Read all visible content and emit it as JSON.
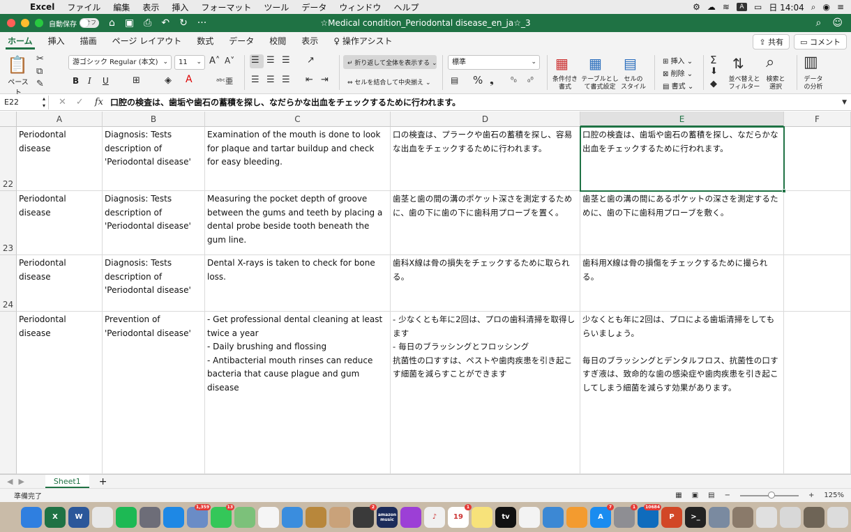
{
  "menubar": {
    "app_name": "Excel",
    "items": [
      "ファイル",
      "編集",
      "表示",
      "挿入",
      "フォーマット",
      "ツール",
      "データ",
      "ウィンドウ",
      "ヘルプ"
    ],
    "clock": "日 14:04",
    "input_method": "A"
  },
  "titlebar": {
    "autosave_label": "自動保存",
    "autosave_state": "オフ",
    "document_title": "☆Medical condition_Periodontal disease_en_ja☆_3"
  },
  "ribbon_tabs": {
    "items": [
      "ホーム",
      "挿入",
      "描画",
      "ページ レイアウト",
      "数式",
      "データ",
      "校閲",
      "表示"
    ],
    "assist": "操作アシスト",
    "share": "共有",
    "comment": "コメント"
  },
  "ribbon": {
    "paste": "ペースト",
    "font_name": "游ゴシック Regular (本文)",
    "font_size": "11",
    "bold": "B",
    "italic": "I",
    "underline": "U",
    "wrap_text": "折り返して全体を表示する",
    "merge_center": "セルを結合して中央揃え",
    "number_format": "標準",
    "conditional_format": "条件付き\n書式",
    "format_as_table": "テーブルとして書式設定",
    "cell_styles": "セルの\nスタイル",
    "insert": "挿入",
    "delete": "削除",
    "format": "書式",
    "sort_filter": "並べ替えと\nフィルター",
    "find_select": "検索と\n選択",
    "analyze_data": "データ\nの分析"
  },
  "formula_bar": {
    "name_box": "E22",
    "fx": "fx",
    "formula": "口腔の検査は、歯垢や歯石の蓄積を探し、なだらかな出血をチェックするために行われます。"
  },
  "grid": {
    "columns": [
      "A",
      "B",
      "C",
      "D",
      "E",
      "F"
    ],
    "selected_column": "E",
    "rows": [
      {
        "num": "22",
        "cells": [
          "Periodontal disease",
          "Diagnosis: Tests description of 'Periodontal disease'",
          "Examination of the mouth is done to look for plaque and tartar buildup and check for easy bleeding.",
          "口の検査は、プラークや歯石の蓄積を探し、容易な出血をチェックするために行われます。",
          "口腔の検査は、歯垢や歯石の蓄積を探し、なだらかな出血をチェックするために行われます。",
          ""
        ]
      },
      {
        "num": "23",
        "cells": [
          "Periodontal disease",
          "Diagnosis: Tests description of 'Periodontal disease'",
          "Measuring the pocket depth of groove between the gums and teeth by placing a dental probe beside tooth beneath the gum line.",
          "歯茎と歯の間の溝のポケット深さを測定するために、歯の下に歯の下に歯科用プローブを置く。",
          "歯茎と歯の溝の間にあるポケットの深さを測定するために、歯の下に歯科用プローブを敷く。",
          ""
        ]
      },
      {
        "num": "24",
        "cells": [
          "Periodontal disease",
          "Diagnosis: Tests description of 'Periodontal disease'",
          "Dental X-rays is taken to check for bone loss.",
          "歯科X線は骨の損失をチェックするために取られる。",
          "歯科用X線は骨の損傷をチェックするために撮られる。",
          ""
        ]
      },
      {
        "num": "",
        "cells": [
          "Periodontal disease",
          "Prevention of 'Periodontal disease'",
          "- Get professional dental cleaning at least twice a year\n- Daily brushing and flossing\n- Antibacterial mouth rinses can reduce bacteria that cause plague and gum disease",
          "- 少なくとも年に2回は、プロの歯科清掃を取得します\n- 毎日のブラッシングとフロッシング\n抗菌性の口すすは、ペストや歯肉疾患を引き起こす細菌を減らすことができます",
          "少なくとも年に2回は、プロによる歯垢清掃をしてもらいましょう。\n\n毎日のブラッシングとデンタルフロス、抗菌性の口すすぎ液は、致命的な歯の感染症や歯肉疾患を引き起こしてしまう細菌を減らす効果があります。",
          ""
        ]
      }
    ]
  },
  "sheets": {
    "tabs": [
      "Sheet1"
    ],
    "add": "+"
  },
  "status": {
    "ready": "準備完了",
    "zoom": "125%",
    "zoom_out": "−",
    "zoom_in": "+"
  },
  "dock": {
    "apps": [
      {
        "name": "finder",
        "label": "",
        "color": "#2f7fe0"
      },
      {
        "name": "excel",
        "label": "X",
        "color": "#1f7244"
      },
      {
        "name": "word",
        "label": "W",
        "color": "#2b579a"
      },
      {
        "name": "chrome",
        "label": "",
        "color": "#e8e8e8"
      },
      {
        "name": "spotify",
        "label": "",
        "color": "#1db954"
      },
      {
        "name": "launchpad",
        "label": "",
        "color": "#6d6d78"
      },
      {
        "name": "safari",
        "label": "",
        "color": "#1e88e5"
      },
      {
        "name": "preview",
        "label": "",
        "color": "#6a8cc6",
        "badge": "1,359"
      },
      {
        "name": "messages",
        "label": "",
        "color": "#34c759",
        "badge": "13"
      },
      {
        "name": "maps",
        "label": "",
        "color": "#7cc17a"
      },
      {
        "name": "photos",
        "label": "",
        "color": "#f5f5f5"
      },
      {
        "name": "zoom-meeting",
        "label": "",
        "color": "#3a8dde"
      },
      {
        "name": "notes-brown",
        "label": "",
        "color": "#b8873b"
      },
      {
        "name": "contacts",
        "label": "",
        "color": "#c9a27a"
      },
      {
        "name": "facetime",
        "label": "",
        "color": "#3a3a3a",
        "badge": "2"
      },
      {
        "name": "amazon-music",
        "label": "amazon music",
        "color": "#1b2b5a"
      },
      {
        "name": "podcasts",
        "label": "",
        "color": "#9c3fd6"
      },
      {
        "name": "music",
        "label": "♪",
        "color": "#f0f0f0"
      },
      {
        "name": "calendar",
        "label": "19",
        "color": "#ffffff",
        "badge": "1"
      },
      {
        "name": "notes",
        "label": "",
        "color": "#f7e27a"
      },
      {
        "name": "apple-tv",
        "label": "tv",
        "color": "#111111"
      },
      {
        "name": "numbers",
        "label": "",
        "color": "#f3f3f3"
      },
      {
        "name": "keynote",
        "label": "",
        "color": "#3c88d4"
      },
      {
        "name": "pages",
        "label": "",
        "color": "#f39b2f"
      },
      {
        "name": "app-store",
        "label": "A",
        "color": "#1a8cf0",
        "badge": "7"
      },
      {
        "name": "system-preferences",
        "label": "",
        "color": "#8e8e93",
        "badge": "1"
      },
      {
        "name": "outlook",
        "label": "",
        "color": "#0f6cbd",
        "badge": "10684"
      },
      {
        "name": "powerpoint",
        "label": "P",
        "color": "#d24726"
      },
      {
        "name": "terminal",
        "label": ">_",
        "color": "#222222"
      },
      {
        "name": "screenshot",
        "label": "",
        "color": "#7a8aa0"
      },
      {
        "name": "window-1",
        "label": "",
        "color": "#8a7a6a"
      },
      {
        "name": "window-2",
        "label": "",
        "color": "#e0e0e0"
      },
      {
        "name": "window-3",
        "label": "",
        "color": "#d8d8d8"
      },
      {
        "name": "window-4",
        "label": "",
        "color": "#6e6456"
      },
      {
        "name": "trash",
        "label": "",
        "color": "#dcdcdc"
      }
    ]
  }
}
